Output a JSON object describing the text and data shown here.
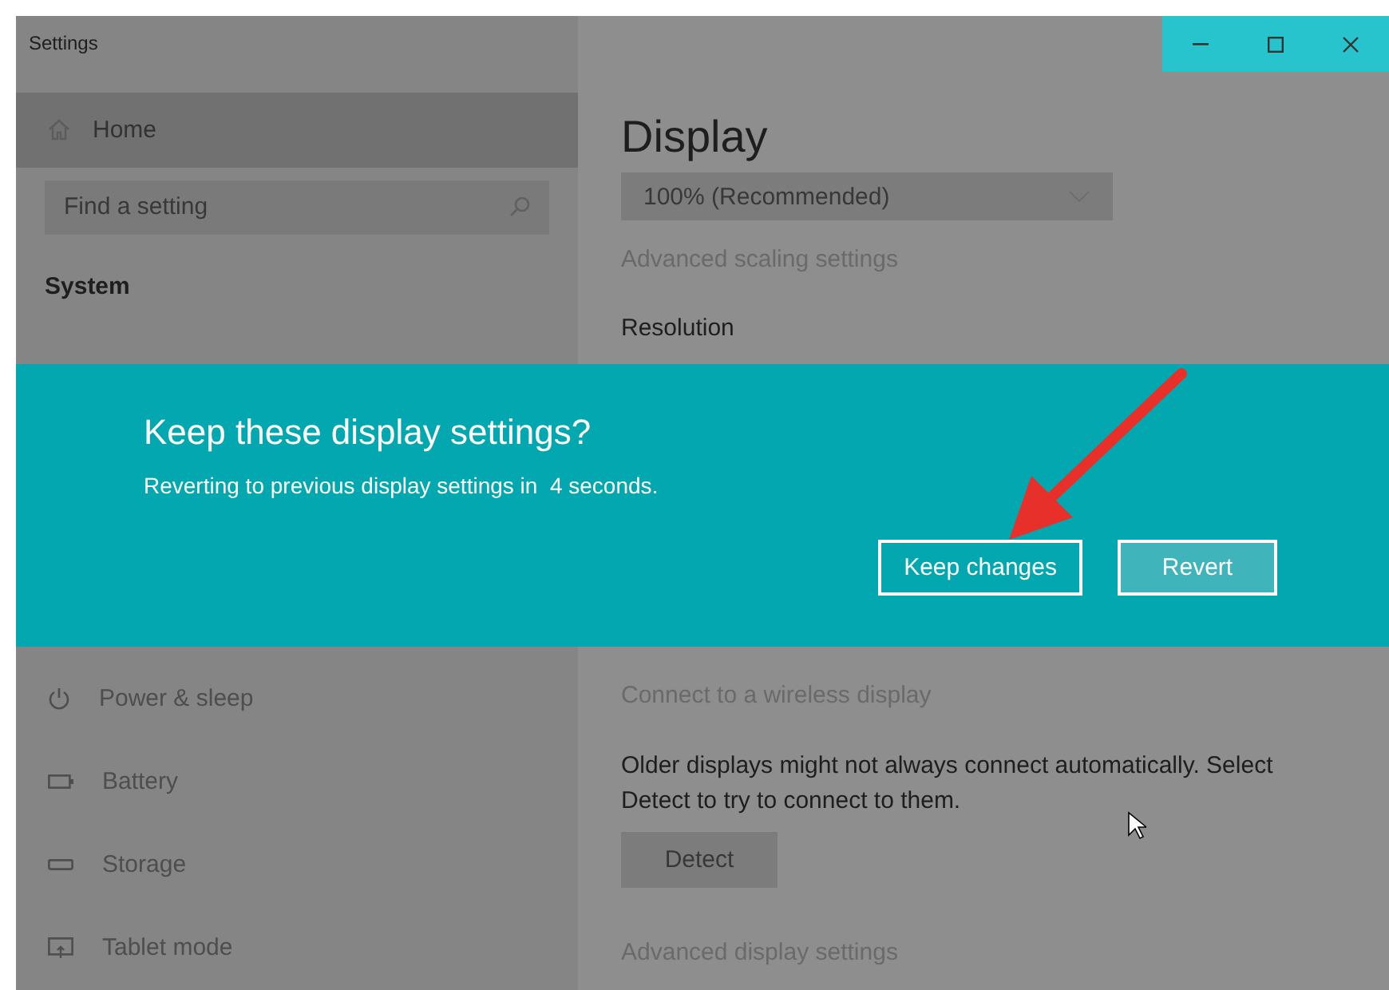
{
  "window": {
    "title": "Settings"
  },
  "sidebar": {
    "home": {
      "label": "Home",
      "selected": true
    },
    "search": {
      "placeholder": "Find a setting"
    },
    "section": "System",
    "items": [
      {
        "label": "Power & sleep",
        "kind": "power"
      },
      {
        "label": "Battery",
        "kind": "battery"
      },
      {
        "label": "Storage",
        "kind": "storage"
      },
      {
        "label": "Tablet mode",
        "kind": "tablet"
      }
    ]
  },
  "content": {
    "heading": "Display",
    "scale_dropdown": {
      "value": "100% (Recommended)"
    },
    "scaling_link": "Advanced scaling settings",
    "resolution_label": "Resolution",
    "wireless_link": "Connect to a wireless display",
    "older_note": "Older displays might not always connect automatically. Select Detect to try to connect to them.",
    "detect_button": "Detect",
    "advanced_link": "Advanced display settings"
  },
  "dialog": {
    "title": "Keep these display settings?",
    "message": "Reverting to previous display settings in  4 seconds.",
    "buttons": [
      {
        "label": "Keep changes",
        "focused": true
      },
      {
        "label": "Revert",
        "focused": false
      }
    ]
  }
}
